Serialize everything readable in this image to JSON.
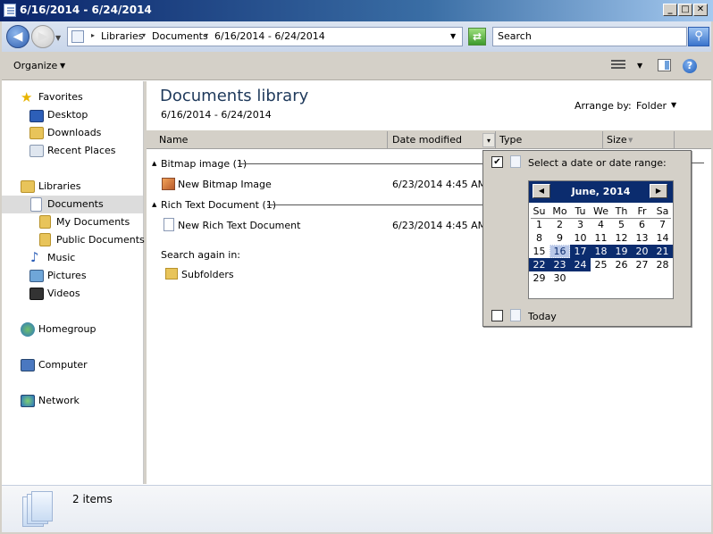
{
  "window": {
    "title": "6/16/2014 - 6/24/2014"
  },
  "address_bar": {
    "breadcrumbs": [
      "Libraries",
      "Documents",
      "6/16/2014 - 6/24/2014"
    ],
    "search_placeholder": "Search"
  },
  "toolbar": {
    "organize_label": "Organize"
  },
  "nav": {
    "favorites": "Favorites",
    "desktop": "Desktop",
    "downloads": "Downloads",
    "recent_places": "Recent Places",
    "libraries": "Libraries",
    "documents": "Documents",
    "my_documents": "My Documents",
    "public_documents": "Public Documents",
    "music": "Music",
    "pictures": "Pictures",
    "videos": "Videos",
    "homegroup": "Homegroup",
    "computer": "Computer",
    "network": "Network"
  },
  "content": {
    "title": "Documents library",
    "subtitle": "6/16/2014 - 6/24/2014",
    "arrange_by_label": "Arrange by:",
    "arrange_by_value": "Folder",
    "columns": {
      "name": "Name",
      "date_modified": "Date modified",
      "type": "Type",
      "size": "Size"
    },
    "groups": [
      {
        "header": "Bitmap image (1)",
        "file": "New Bitmap Image",
        "date": "6/23/2014 4:45 AM"
      },
      {
        "header": "Rich Text Document (1)",
        "file": "New Rich Text Document",
        "date": "6/23/2014 4:45 AM"
      }
    ],
    "search_again": "Search again in:",
    "subfolders": "Subfolders"
  },
  "date_filter": {
    "select_label": "Select a date or date range:",
    "select_checked": true,
    "today_label": "Today",
    "today_checked": false,
    "calendar": {
      "month_title": "June, 2014",
      "weekdays": [
        "Su",
        "Mo",
        "Tu",
        "We",
        "Th",
        "Fr",
        "Sa"
      ],
      "weeks": [
        [
          "1",
          "2",
          "3",
          "4",
          "5",
          "6",
          "7"
        ],
        [
          "8",
          "9",
          "10",
          "11",
          "12",
          "13",
          "14"
        ],
        [
          "15",
          "16",
          "17",
          "18",
          "19",
          "20",
          "21"
        ],
        [
          "22",
          "23",
          "24",
          "25",
          "26",
          "27",
          "28"
        ],
        [
          "29",
          "30",
          "",
          "",
          "",
          "",
          ""
        ]
      ],
      "range_start": "16",
      "range_end": "24"
    }
  },
  "status": {
    "items_text": "2 items"
  }
}
